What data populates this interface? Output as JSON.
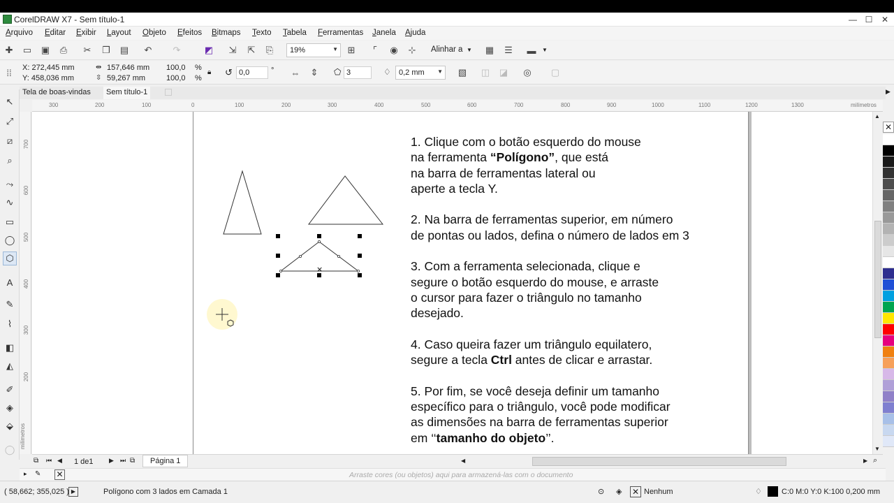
{
  "titlebar": {
    "title": "CorelDRAW X7 - Sem título-1",
    "minimize": "—",
    "maximize": "☐",
    "close": "✕"
  },
  "menu": [
    "Arquivo",
    "Editar",
    "Exibir",
    "Layout",
    "Objeto",
    "Efeitos",
    "Bitmaps",
    "Texto",
    "Tabela",
    "Ferramentas",
    "Janela",
    "Ajuda"
  ],
  "toolbar": {
    "zoom": "19%",
    "snap_label": "Alinhar a"
  },
  "propbar": {
    "x": "X: 272,445 mm",
    "y": "Y: 458,036 mm",
    "width": "157,646 mm",
    "height": "59,267 mm",
    "scale_x": "100,0",
    "scale_y": "100,0",
    "pct": "%",
    "rotation": "0,0",
    "degree": "°",
    "sides": "3",
    "outline": "0,2 mm"
  },
  "tabs": [
    "Tela de boas-vindas",
    "Sem título-1"
  ],
  "hruler": {
    "ticks": [
      "300",
      "200",
      "100",
      "0",
      "100",
      "200",
      "300",
      "400",
      "500",
      "600",
      "700",
      "800",
      "900",
      "1000",
      "1100",
      "1200",
      "1300"
    ],
    "unit": "milímetros"
  },
  "vruler": {
    "ticks": [
      "700",
      "600",
      "500",
      "400",
      "300",
      "200"
    ],
    "unit": "milímetros"
  },
  "instructions": {
    "s1_a": "1. Clique com o botão esquerdo do mouse",
    "s1_b": "na ferramenta ",
    "s1_bold": "“Polígono”",
    "s1_c": ", que está",
    "s1_d": "na barra de ferramentas lateral ou",
    "s1_e": "aperte a tecla Y.",
    "s2_a": "2. Na barra de ferramentas superior, em número",
    "s2_b": "de pontas ou lados, defina o número de lados em 3",
    "s3_a": "3. Com a ferramenta selecionada, clique e",
    "s3_b": "segure o botão esquerdo do mouse, e arraste",
    "s3_c": "o cursor para fazer o triângulo no tamanho",
    "s3_d": "desejado.",
    "s4_a": "4. Caso queira fazer um triângulo equilatero,",
    "s4_b": "segure a tecla ",
    "s4_bold": "Ctrl",
    "s4_c": " antes de clicar e arrastar.",
    "s5_a": "5. Por fim, se você deseja definir um tamanho",
    "s5_b": "específico para o triângulo, você pode modificar",
    "s5_c": "as dimensões na barra de ferramentas superior",
    "s5_d": "em ",
    "s5_q1": "‘‘",
    "s5_bold": "tamanho do objeto",
    "s5_q2": "’’."
  },
  "pagenav": {
    "counter": "1 de1",
    "page_tab": "Página 1"
  },
  "docpalette_hint": "Arraste cores (ou objetos) aqui para armazená-las com o documento",
  "status": {
    "coords": "( 58,662; 355,025 )",
    "selection": "Polígono com 3 lados em Camada 1",
    "fill": "Nenhum",
    "outline": "C:0 M:0 Y:0 K:100  0,200 mm"
  },
  "palette": [
    "#ffffff",
    "#000000",
    "#1a1a1a",
    "#333333",
    "#4d4d4d",
    "#666666",
    "#808080",
    "#999999",
    "#b3b3b3",
    "#cccccc",
    "#e6e6e6",
    "#ffffff",
    "#2e2e8f",
    "#1f4fd6",
    "#00a0e0",
    "#00a550",
    "#ffe600",
    "#ff0000",
    "#e6007e",
    "#f08010",
    "#f6a05a",
    "#d7b8e8",
    "#b0a0d8",
    "#9080c8",
    "#7f7fd0",
    "#a8c0e8",
    "#c8d8f0",
    "#e0e8f8"
  ]
}
